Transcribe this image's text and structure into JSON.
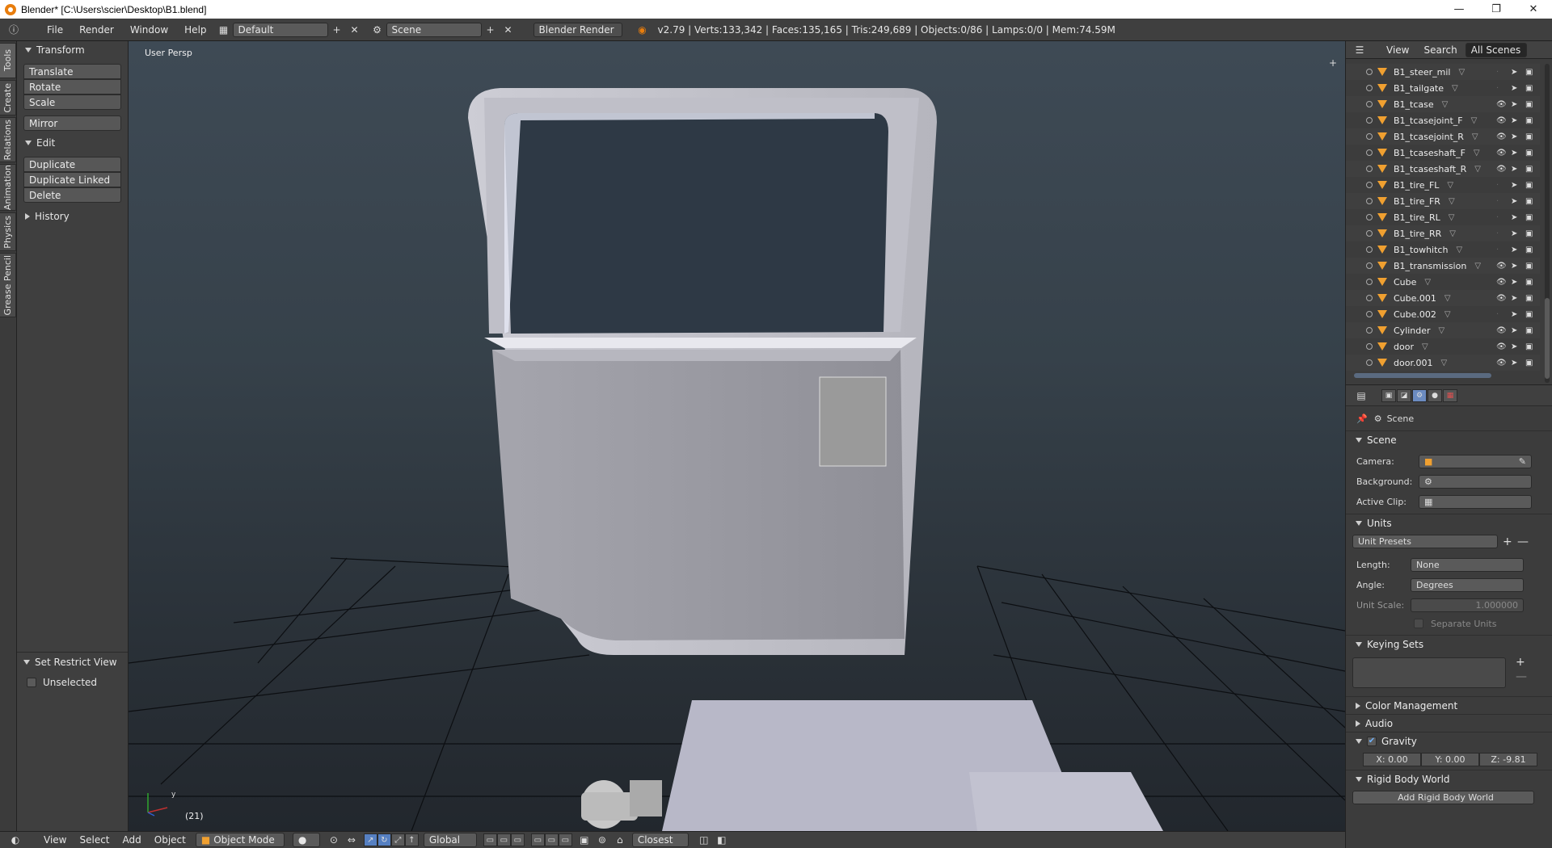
{
  "window": {
    "title": "Blender* [C:\\Users\\scier\\Desktop\\B1.blend]",
    "minimize": "—",
    "restore": "❐",
    "close": "✕"
  },
  "infobar": {
    "menus": [
      "File",
      "Render",
      "Window",
      "Help"
    ],
    "layout": "Default",
    "scene": "Scene",
    "engine": "Blender Render",
    "stats": "v2.79 | Verts:133,342 | Faces:135,165 | Tris:249,689 | Objects:0/86 | Lamps:0/0 | Mem:74.59M"
  },
  "tool_tabs": [
    "Tools",
    "Create",
    "Relations",
    "Animation",
    "Physics",
    "Grease Pencil"
  ],
  "tool_panel": {
    "transform_header": "Transform",
    "translate": "Translate",
    "rotate": "Rotate",
    "scale": "Scale",
    "mirror": "Mirror",
    "edit_header": "Edit",
    "duplicate": "Duplicate",
    "duplicate_linked": "Duplicate Linked",
    "delete": "Delete",
    "history_header": "History",
    "restrict_header": "Set Restrict View",
    "unselected": "Unselected"
  },
  "viewport": {
    "label": "User Persp",
    "frame": "(21)",
    "axis_y": "y"
  },
  "bottombar": {
    "menus": [
      "View",
      "Select",
      "Add",
      "Object"
    ],
    "mode": "Object Mode",
    "orientation": "Global",
    "snap": "Closest"
  },
  "outliner": {
    "view": "View",
    "search": "Search",
    "scope": "All Scenes",
    "items": [
      {
        "name": "B1_steer_mil",
        "visible": false
      },
      {
        "name": "B1_tailgate",
        "visible": false
      },
      {
        "name": "B1_tcase",
        "visible": true
      },
      {
        "name": "B1_tcasejoint_F",
        "visible": true
      },
      {
        "name": "B1_tcasejoint_R",
        "visible": true
      },
      {
        "name": "B1_tcaseshaft_F",
        "visible": true
      },
      {
        "name": "B1_tcaseshaft_R",
        "visible": true
      },
      {
        "name": "B1_tire_FL",
        "visible": false
      },
      {
        "name": "B1_tire_FR",
        "visible": false
      },
      {
        "name": "B1_tire_RL",
        "visible": false
      },
      {
        "name": "B1_tire_RR",
        "visible": false
      },
      {
        "name": "B1_towhitch",
        "visible": false
      },
      {
        "name": "B1_transmission",
        "visible": true
      },
      {
        "name": "Cube",
        "visible": true
      },
      {
        "name": "Cube.001",
        "visible": true
      },
      {
        "name": "Cube.002",
        "visible": false
      },
      {
        "name": "Cylinder",
        "visible": true
      },
      {
        "name": "door",
        "visible": true
      },
      {
        "name": "door.001",
        "visible": true
      }
    ]
  },
  "properties": {
    "context": "Scene",
    "scene_header": "Scene",
    "camera_label": "Camera:",
    "background_label": "Background:",
    "active_clip_label": "Active Clip:",
    "units_header": "Units",
    "unit_presets": "Unit Presets",
    "length_label": "Length:",
    "length_value": "None",
    "angle_label": "Angle:",
    "angle_value": "Degrees",
    "unit_scale_label": "Unit Scale:",
    "unit_scale_value": "1.000000",
    "separate_units": "Separate Units",
    "keying_header": "Keying Sets",
    "color_mgmt": "Color Management",
    "audio": "Audio",
    "gravity": "Gravity",
    "gx": "X:  0.00",
    "gy": "Y:  0.00",
    "gz": "Z:  -9.81",
    "rigid_body": "Rigid Body World",
    "add_rigid": "Add Rigid Body World"
  },
  "colors": {
    "accent": "#5680c2",
    "object_icon": "#f0a030",
    "blender_orange": "#e87d0d"
  }
}
